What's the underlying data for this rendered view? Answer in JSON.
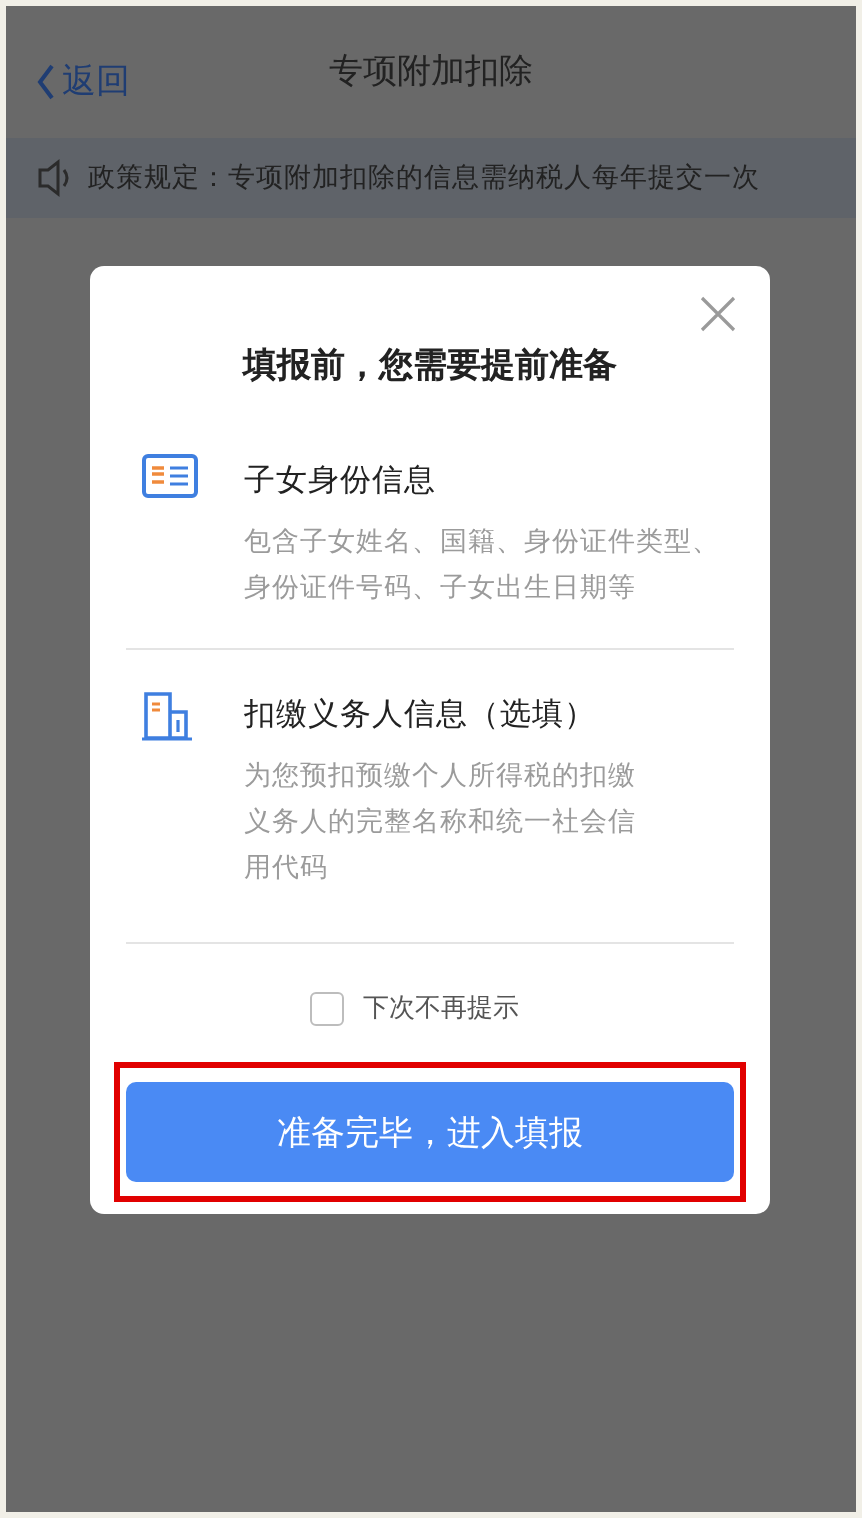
{
  "nav": {
    "back_label": "返回",
    "title": "专项附加扣除"
  },
  "notice": {
    "text": "政策规定：专项附加扣除的信息需纳税人每年提交一次"
  },
  "dialog": {
    "title": "填报前，您需要提前准备",
    "items": [
      {
        "kind": "child",
        "title": "子女身份信息",
        "description": "包含子女姓名、国籍、身份证件类型、身份证件号码、子女出生日期等"
      },
      {
        "kind": "employer",
        "title": "扣缴义务人信息（选填）",
        "description": "为您预扣预缴个人所得税的扣缴义务人的完整名称和统一社会信用代码"
      }
    ],
    "checkbox": {
      "label": "下次不再提示",
      "checked": false
    },
    "button": {
      "label": "准备完毕，进入填报",
      "highlighted": true
    }
  }
}
